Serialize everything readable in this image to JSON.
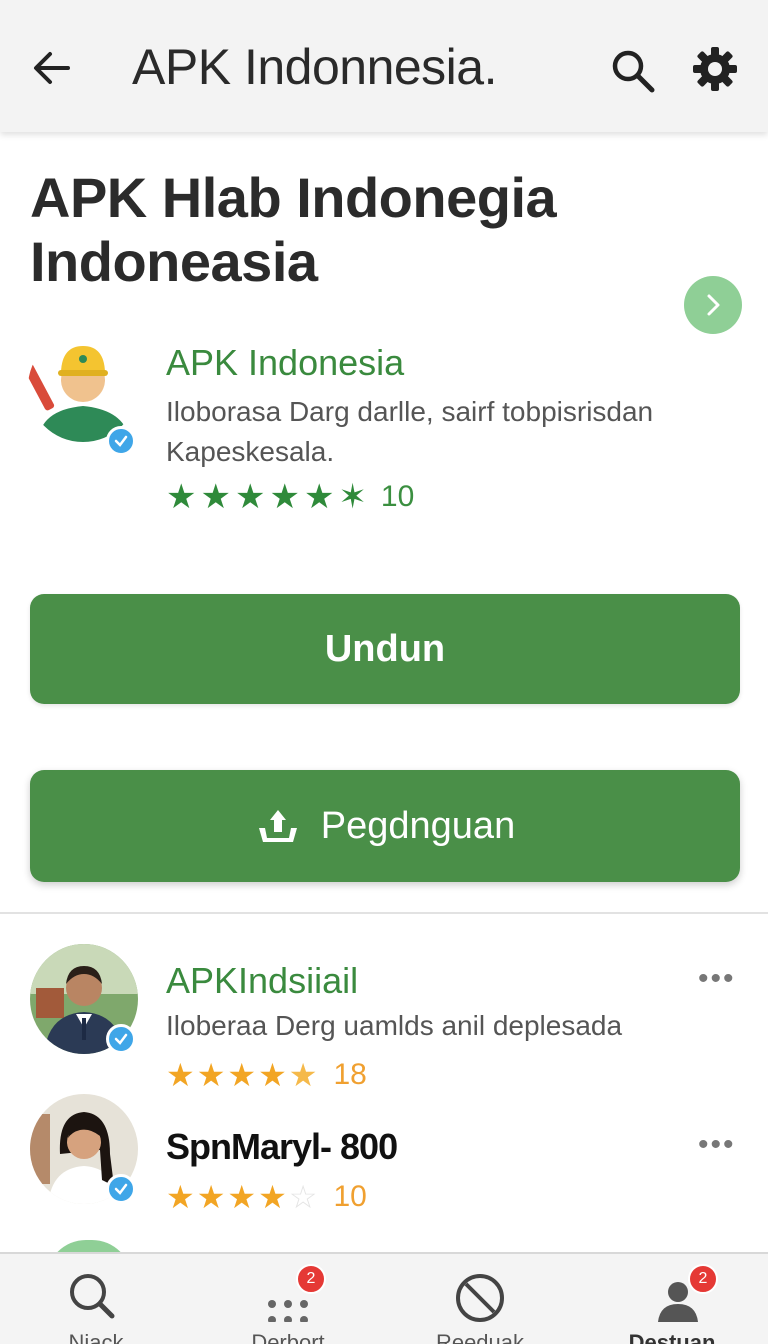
{
  "appbar": {
    "title": "APK Indonnesia.",
    "back_icon": "arrow-left-icon",
    "search_icon": "search-icon",
    "settings_icon": "gear-icon"
  },
  "headline": "APK Hlab Indonegia Indoneasia",
  "app": {
    "name": "APK Indonesia",
    "description": "Iloborasa Darg darlle, sairf tobpisrisdan Kapeskesala.",
    "rating_value": "10",
    "stars": 6
  },
  "buttons": {
    "primary_label": "Undun",
    "secondary_label": "Pegdnguan",
    "secondary_icon": "upload-icon"
  },
  "reviews": [
    {
      "name": "APKIndsiiail",
      "text": "Iloberaa Derg uamlds anil deplesada",
      "rating_value": "18",
      "stars": 4.5
    },
    {
      "name": "SpnMaryl- 800",
      "text": "",
      "rating_value": "10",
      "stars": 4
    }
  ],
  "bottom_nav": [
    {
      "label": "Niack",
      "icon": "search-icon",
      "badge": ""
    },
    {
      "label": "Derbort",
      "icon": "dots-grid-icon",
      "badge": "2"
    },
    {
      "label": "Reeduak",
      "icon": "blocked-icon",
      "badge": ""
    },
    {
      "label": "Destuan",
      "icon": "person-icon",
      "badge": "2"
    }
  ],
  "colors": {
    "accent_green": "#4a8f48",
    "name_green": "#3a8a3e",
    "star_gold": "#f2a524",
    "badge_red": "#e53935",
    "verify_blue": "#3fa6e8"
  }
}
